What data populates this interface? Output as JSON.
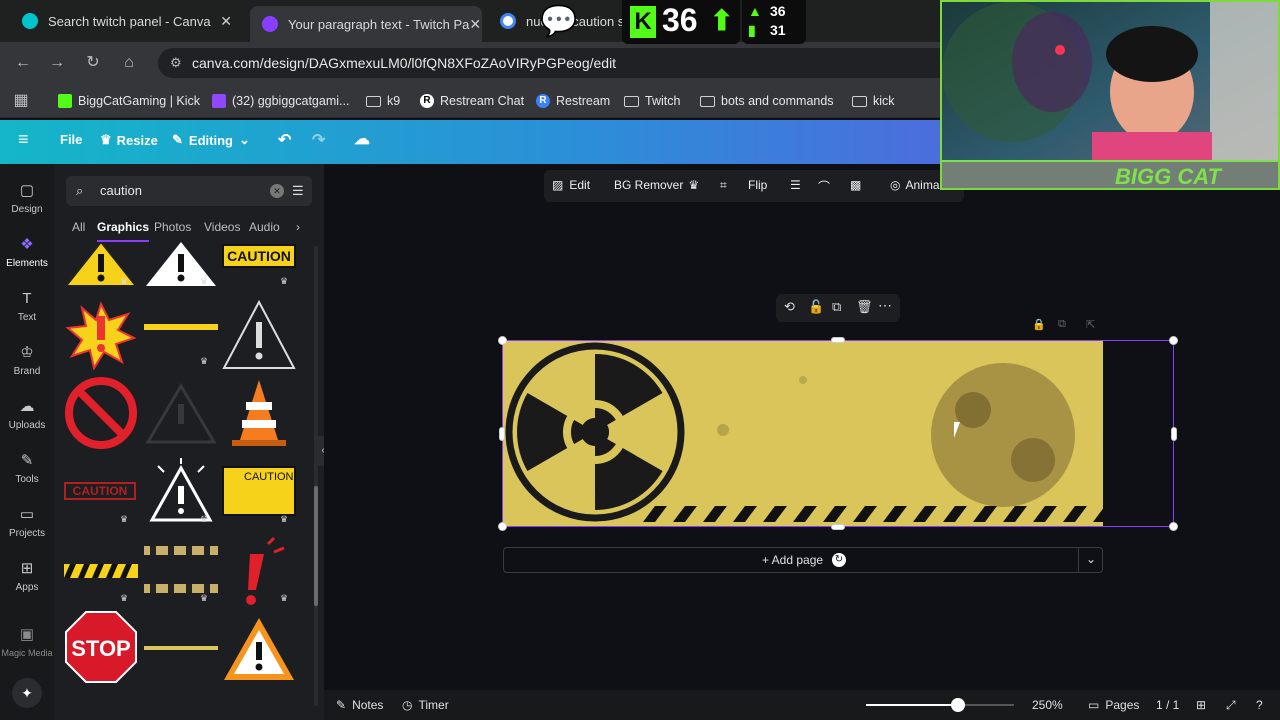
{
  "browser": {
    "tabs": [
      {
        "title": "Search twitch panel - Canva",
        "favicon_color": "#00c4cc",
        "active": false
      },
      {
        "title": "Your paragraph text - Twitch Pa",
        "favicon_color": "#8b3dff",
        "active": true
      },
      {
        "title": "nuclear caution sign - Google",
        "favicon_color": "#4285f4",
        "active": false
      }
    ],
    "url": "canva.com/design/DAGxmexuLM0/l0fQN8XFoZAoVIRyPGPeog/edit",
    "bookmarks": [
      {
        "label": "BiggCatGaming | Kick",
        "icon": "kick-icon",
        "color": "#53fc18"
      },
      {
        "label": "(32) ggbiggcatgami...",
        "icon": "twitch-icon",
        "color": "#9146ff"
      },
      {
        "label": "k9",
        "icon": "folder-icon"
      },
      {
        "label": "Restream Chat",
        "icon": "restream-icon",
        "color": "#ffffff"
      },
      {
        "label": "Restream",
        "icon": "restream-icon",
        "color": "#3b82f6"
      },
      {
        "label": "Twitch",
        "icon": "folder-icon"
      },
      {
        "label": "bots and commands",
        "icon": "folder-icon"
      },
      {
        "label": "kick",
        "icon": "folder-icon"
      }
    ]
  },
  "canva": {
    "menu": {
      "file": "File",
      "resize": "Resize",
      "editing": "Editing"
    },
    "rail": [
      {
        "label": "Design",
        "icon": "design-icon"
      },
      {
        "label": "Elements",
        "icon": "elements-icon",
        "active": true
      },
      {
        "label": "Text",
        "icon": "text-icon"
      },
      {
        "label": "Brand",
        "icon": "brand-icon"
      },
      {
        "label": "Uploads",
        "icon": "uploads-icon"
      },
      {
        "label": "Tools",
        "icon": "tools-icon"
      },
      {
        "label": "Projects",
        "icon": "projects-icon"
      },
      {
        "label": "Apps",
        "icon": "apps-icon"
      },
      {
        "label": "Magic Media",
        "icon": "magic-media-icon"
      }
    ],
    "search_value": "caution",
    "panel_tabs": [
      "All",
      "Graphics",
      "Photos",
      "Videos",
      "Audio"
    ],
    "active_panel_tab": "Graphics",
    "caution_labels": [
      "CAUTION",
      "CAUTION",
      "CAUTION"
    ],
    "stop_label": "STOP",
    "context_toolbar": {
      "edit": "Edit",
      "bg_remover": "BG Remover",
      "flip": "Flip",
      "animate": "Anima"
    },
    "add_page": "+ Add page",
    "bottom": {
      "notes": "Notes",
      "timer": "Timer",
      "zoom": "250%",
      "pages_label": "Pages",
      "page_count": "1 / 1",
      "zoom_level": 0.62
    },
    "colors": {
      "accent": "#8b3dff",
      "design_bg": "#d9c55a"
    }
  },
  "stream_overlay": {
    "kick_count": "36",
    "stat_top": "36",
    "stat_bottom": "31",
    "webcam_banner": "BIGG CAT"
  }
}
